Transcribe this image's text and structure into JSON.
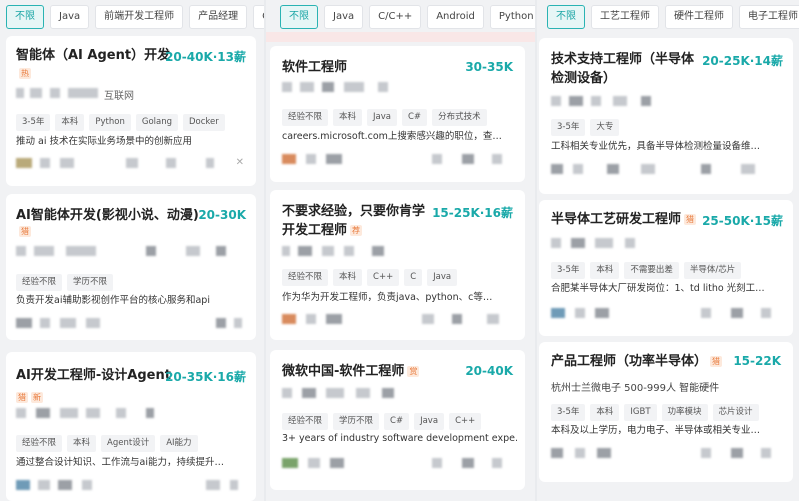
{
  "columns": [
    {
      "filters": [
        "不限",
        "Java",
        "前端开发工程师",
        "产品经理",
        "C"
      ],
      "cards": [
        {
          "title": "智能体（AI Agent）开发",
          "salary": "20-40K·13薪",
          "badge": "热",
          "company": "互联网",
          "tags": [
            "3-5年",
            "本科",
            "Python",
            "Golang",
            "Docker"
          ],
          "desc": "推动 ai 技术在实际业务场景中的创新应用"
        },
        {
          "title": "AI智能体开发(影视小说、动漫)",
          "salary": "20-30K",
          "badge": "猎",
          "tags": [
            "经验不限",
            "学历不限"
          ],
          "desc": "负责开发ai辅助影视创作平台的核心服务和api"
        },
        {
          "title": "AI开发工程师-设计Agent",
          "salary": "20-35K·16薪",
          "badges": [
            "猎",
            "新"
          ],
          "tags": [
            "经验不限",
            "本科",
            "Agent设计",
            "AI能力"
          ],
          "desc": "通过整合设计知识、工作流与ai能力，持续提升…"
        }
      ]
    },
    {
      "filters": [
        "不限",
        "Java",
        "C/C++",
        "Android",
        "Python"
      ],
      "cards": [
        {
          "title": "软件工程师",
          "salary": "30-35K",
          "tags": [
            "经验不限",
            "本科",
            "Java",
            "C#",
            "分布式技术"
          ],
          "desc": "careers.microsoft.com上搜索感兴趣的职位，查…"
        },
        {
          "title_line1": "不要求经验，只要你肯学",
          "title_line2": "开发工程师",
          "salary": "15-25K·16薪",
          "badge": "荐",
          "tags": [
            "经验不限",
            "本科",
            "C++",
            "C",
            "Java"
          ],
          "desc": "作为华为开发工程师，负责java、python、c等…"
        },
        {
          "title": "微软中国-软件工程师",
          "salary": "20-40K",
          "badge": "赏",
          "tags": [
            "经验不限",
            "学历不限",
            "C#",
            "Java",
            "C++"
          ],
          "desc": "3+ years of industry software development expe…"
        }
      ]
    },
    {
      "filters": [
        "不限",
        "工艺工程师",
        "硬件工程师",
        "电子工程师"
      ],
      "cards": [
        {
          "title_line1": "技术支持工程师（半导体",
          "title_line2": "检测设备）",
          "salary": "20-25K·14薪",
          "tags": [
            "3-5年",
            "大专"
          ],
          "desc": "工科相关专业优先，具备半导体检测检量设备维…"
        },
        {
          "title": "半导体工艺研发工程师",
          "salary": "25-50K·15薪",
          "badge": "猎",
          "tags": [
            "3-5年",
            "本科",
            "不需要出差",
            "半导体/芯片"
          ],
          "desc": "合肥某半导体大厂研发岗位：1、td litho 光刻工…"
        },
        {
          "title": "产品工程师（功率半导体）",
          "salary": "15-22K",
          "badge": "猎",
          "company": "杭州士兰微电子 500-999人 智能硬件",
          "tags": [
            "3-5年",
            "本科",
            "IGBT",
            "功率模块",
            "芯片设计"
          ],
          "desc": "本科及以上学历，电力电子、半导体或相关专业…"
        }
      ]
    }
  ]
}
